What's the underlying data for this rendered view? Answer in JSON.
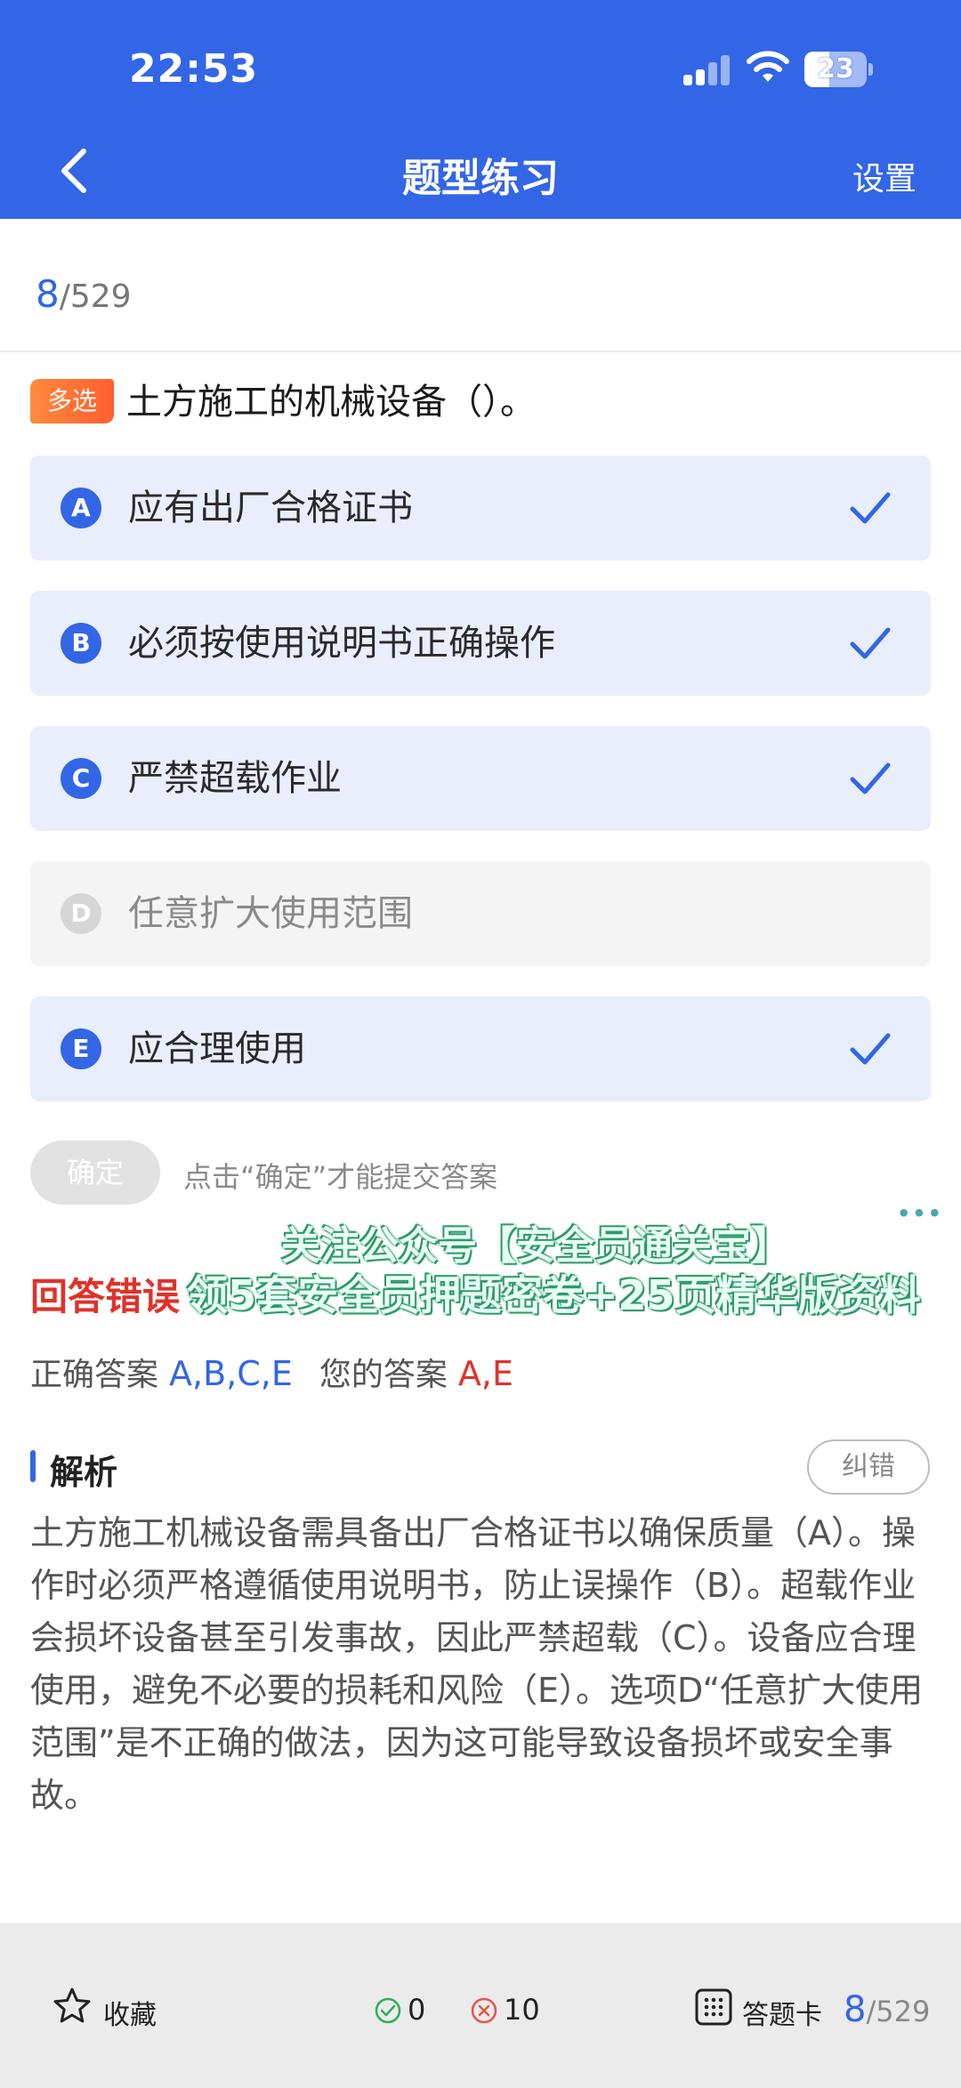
{
  "status_bar": {
    "time": "22:53",
    "battery": "23"
  },
  "nav": {
    "title": "题型练习",
    "settings": "设置"
  },
  "progress": {
    "current": "8",
    "total": "/529"
  },
  "question": {
    "type_badge": "多选",
    "text": "土方施工的机械设备（）。"
  },
  "options": [
    {
      "letter": "A",
      "text": "应有出厂合格证书",
      "selected": true
    },
    {
      "letter": "B",
      "text": "必须按使用说明书正确操作",
      "selected": true
    },
    {
      "letter": "C",
      "text": "严禁超载作业",
      "selected": true
    },
    {
      "letter": "D",
      "text": "任意扩大使用范围",
      "selected": false
    },
    {
      "letter": "E",
      "text": "应合理使用",
      "selected": true
    }
  ],
  "confirm": {
    "label": "确定",
    "hint": "点击“确定”才能提交答案"
  },
  "overlay": {
    "more": "•••",
    "line1": "关注公众号【安全员通关宝】",
    "line2": "领5套安全员押题密卷+25页精华版资料"
  },
  "result": {
    "wrong_label": "回答错误",
    "correct_label": "正确答案",
    "correct_value": "A,B,C,E",
    "yours_label": "您的答案",
    "yours_value": "A,E"
  },
  "analysis": {
    "title": "解析",
    "report_button": "纠错",
    "text": "土方施工机械设备需具备出厂合格证书以确保质量（A）。操作时必须严格遵循使用说明书，防止误操作（B）。超载作业会损坏设备甚至引发事故，因此严禁超载（C）。设备应合理使用，避免不必要的损耗和风险（E）。选项D“任意扩大使用范围”是不正确的做法，因为这可能导致设备损坏或安全事故。"
  },
  "bottom_bar": {
    "favorite": "收藏",
    "right_count": "0",
    "wrong_count": "10",
    "answer_card": "答题卡",
    "progress_current": "8",
    "progress_total": "/529"
  },
  "colors": {
    "primary": "#3366e6",
    "error": "#e0322a",
    "badge": "#ff6a33",
    "option_selected_bg": "#e9eefc"
  }
}
